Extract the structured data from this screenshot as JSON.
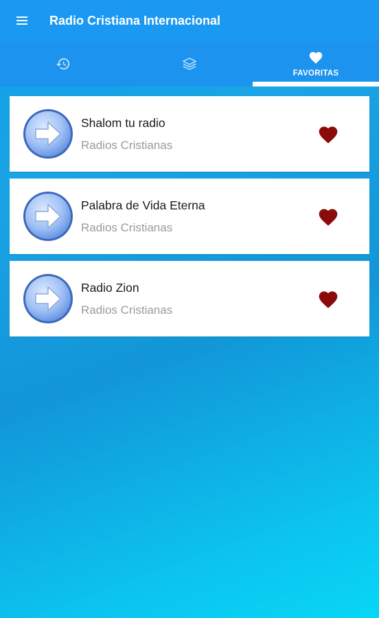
{
  "app": {
    "title": "Radio Cristiana Internacional",
    "menu_icon": "hamburger-menu-icon",
    "colors": {
      "appbar": "#1a98f2",
      "tabbar": "#1b93ef",
      "heart": "#8b0a0a",
      "name_text": "#1a1a1a",
      "category_text": "#9a9a9a"
    }
  },
  "tabs": [
    {
      "icon": "history-icon",
      "label": "",
      "active": false
    },
    {
      "icon": "layers-icon",
      "label": "",
      "active": false
    },
    {
      "icon": "heart-icon",
      "label": "FAVORITAS",
      "active": true
    }
  ],
  "stations": [
    {
      "name": "Shalom tu radio",
      "category": "Radios Cristianas",
      "icon": "arrow-right-circle-icon",
      "favorite": true
    },
    {
      "name": "Palabra de Vida Eterna",
      "category": "Radios Cristianas",
      "icon": "arrow-right-circle-icon",
      "favorite": true
    },
    {
      "name": "Radio Zion",
      "category": "Radios Cristianas",
      "icon": "arrow-right-circle-icon",
      "favorite": true
    }
  ]
}
